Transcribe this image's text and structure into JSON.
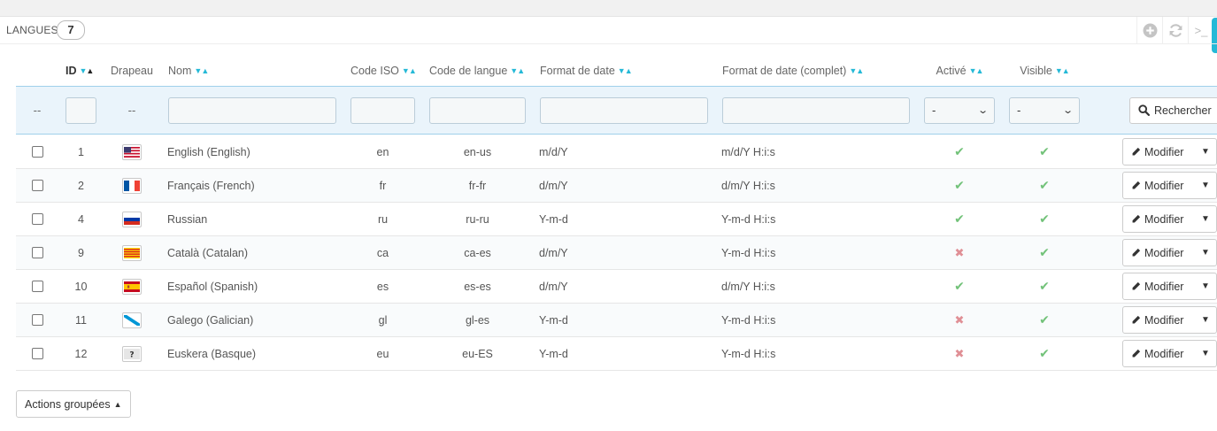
{
  "panel": {
    "title": "LANGUES",
    "count": "7"
  },
  "toolbar": {
    "add_icon": "plus-circle-icon",
    "refresh_icon": "refresh-icon",
    "sql_icon": "terminal-icon",
    "sql_label": ">_"
  },
  "columns": {
    "id": "ID",
    "flag": "Drapeau",
    "name": "Nom",
    "iso": "Code ISO",
    "lang": "Code de langue",
    "date": "Format de date",
    "datefull": "Format de date (complet)",
    "active": "Activé",
    "visible": "Visible"
  },
  "sort_glyphs": {
    "desc": "▼",
    "asc": "▲"
  },
  "filters": {
    "empty": "--",
    "active_value": "-",
    "visible_value": "-",
    "chevron": "⌄",
    "search_label": "Rechercher"
  },
  "rows": [
    {
      "id": "1",
      "flag": "us",
      "name": "English (English)",
      "iso": "en",
      "lang": "en-us",
      "date": "m/d/Y",
      "datefull": "m/d/Y H:i:s",
      "active": true,
      "visible": true
    },
    {
      "id": "2",
      "flag": "fr",
      "name": "Français (French)",
      "iso": "fr",
      "lang": "fr-fr",
      "date": "d/m/Y",
      "datefull": "d/m/Y H:i:s",
      "active": true,
      "visible": true
    },
    {
      "id": "4",
      "flag": "ru",
      "name": "Russian",
      "iso": "ru",
      "lang": "ru-ru",
      "date": "Y-m-d",
      "datefull": "Y-m-d H:i:s",
      "active": true,
      "visible": true
    },
    {
      "id": "9",
      "flag": "ca",
      "name": "Català (Catalan)",
      "iso": "ca",
      "lang": "ca-es",
      "date": "d/m/Y",
      "datefull": "Y-m-d H:i:s",
      "active": false,
      "visible": true
    },
    {
      "id": "10",
      "flag": "es",
      "name": "Español (Spanish)",
      "iso": "es",
      "lang": "es-es",
      "date": "d/m/Y",
      "datefull": "d/m/Y H:i:s",
      "active": true,
      "visible": true
    },
    {
      "id": "11",
      "flag": "gl",
      "name": "Galego (Galician)",
      "iso": "gl",
      "lang": "gl-es",
      "date": "Y-m-d",
      "datefull": "Y-m-d H:i:s",
      "active": false,
      "visible": true
    },
    {
      "id": "12",
      "flag": "unknown",
      "name": "Euskera (Basque)",
      "iso": "eu",
      "lang": "eu-ES",
      "date": "Y-m-d",
      "datefull": "Y-m-d H:i:s",
      "active": false,
      "visible": true
    }
  ],
  "row_action": {
    "label": "Modifier",
    "icon": "pencil-icon",
    "caret": "▼"
  },
  "bulk": {
    "label": "Actions groupées",
    "caret": "▲"
  },
  "status_glyphs": {
    "yes": "✔",
    "no": "✖"
  },
  "colors": {
    "accent": "#25b9d7",
    "check": "#72c279",
    "cross": "#e08f95",
    "filter_bg": "#eaf4fb"
  }
}
